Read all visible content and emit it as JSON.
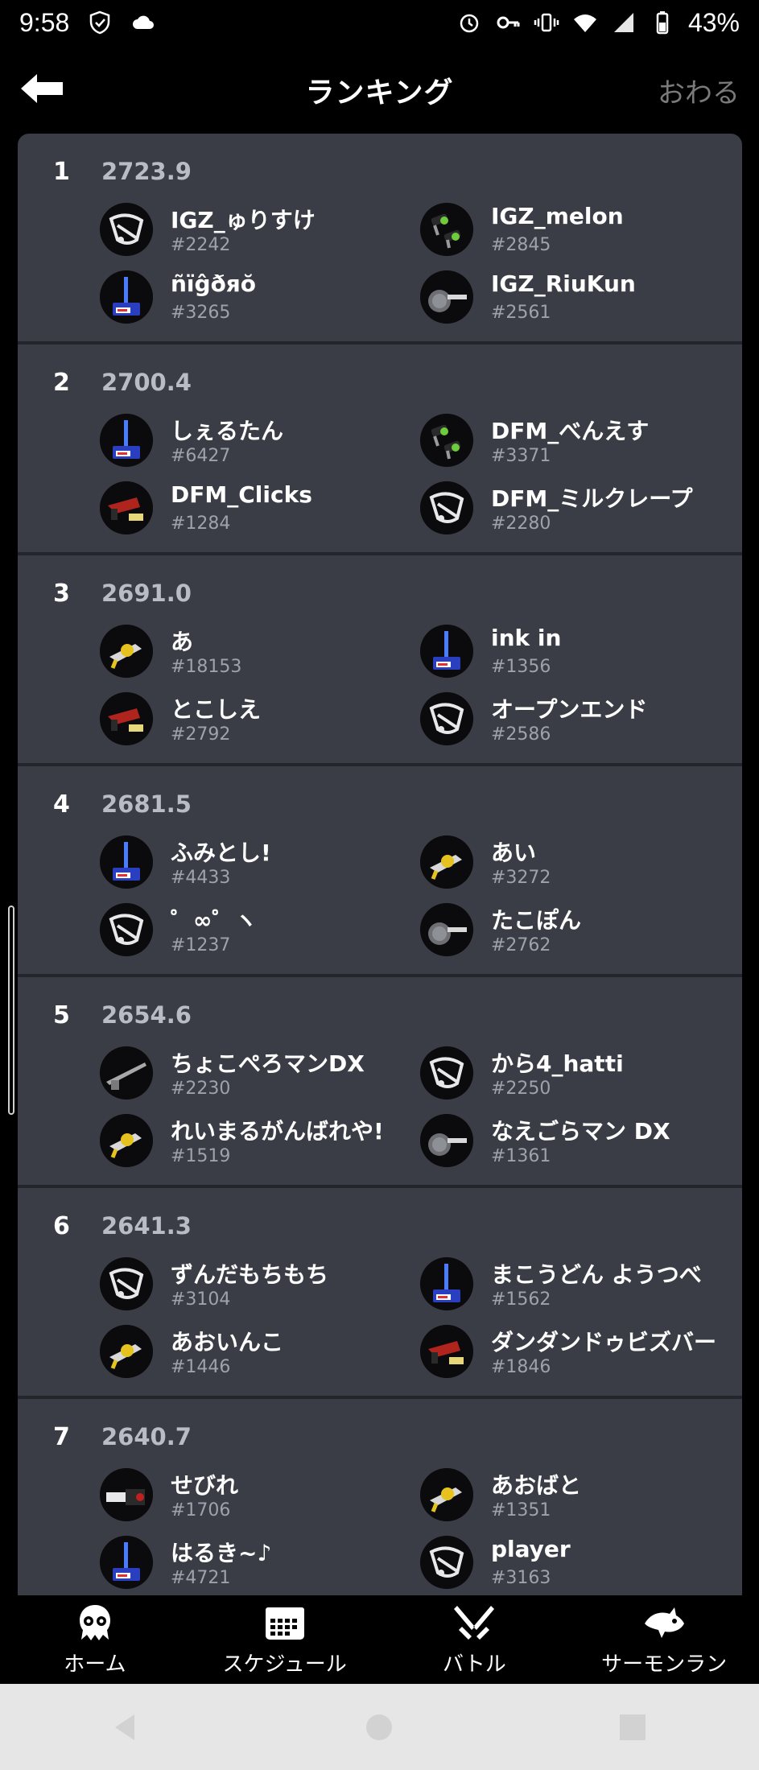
{
  "status_bar": {
    "time": "9:58",
    "battery": "43%",
    "icons": [
      "shield-icon",
      "cloud-icon",
      "alarm-icon",
      "key-icon",
      "vibrate-icon",
      "wifi-icon",
      "signal-icon",
      "battery-icon"
    ]
  },
  "header": {
    "title": "ランキング",
    "quit_label": "おわる",
    "back_icon": "back-arrow-icon"
  },
  "colors": {
    "background": "#000000",
    "panel": "#3a3d45",
    "divider": "#23252b",
    "score": "#b8bcc4",
    "tag": "#9ea2aa",
    "quit": "#7a7a7a"
  },
  "rankings": [
    {
      "rank": "1",
      "score": "2723.9",
      "players": [
        {
          "name": "IGZ_ゅりすけ",
          "tag": "#2242",
          "weapon": "brella"
        },
        {
          "name": "IGZ_melon",
          "tag": "#2845",
          "weapon": "dualie-green"
        },
        {
          "name": "ñïĝðяŏ",
          "tag": "#3265",
          "weapon": "roller-blue"
        },
        {
          "name": "IGZ_RiuKun",
          "tag": "#2561",
          "weapon": "brush-gray"
        }
      ]
    },
    {
      "rank": "2",
      "score": "2700.4",
      "players": [
        {
          "name": "しぇるたん",
          "tag": "#6427",
          "weapon": "roller-blue"
        },
        {
          "name": "DFM_べんえす",
          "tag": "#3371",
          "weapon": "dualie-green"
        },
        {
          "name": "DFM_Clicks",
          "tag": "#1284",
          "weapon": "blaster-red"
        },
        {
          "name": "DFM_ミルクレープ",
          "tag": "#2280",
          "weapon": "brella"
        }
      ]
    },
    {
      "rank": "3",
      "score": "2691.0",
      "players": [
        {
          "name": "あ",
          "tag": "#18153",
          "weapon": "gun-yellow"
        },
        {
          "name": "ink in",
          "tag": "#1356",
          "weapon": "roller-blue"
        },
        {
          "name": "とこしえ",
          "tag": "#2792",
          "weapon": "blaster-red"
        },
        {
          "name": "オープンエンド",
          "tag": "#2586",
          "weapon": "brella"
        }
      ]
    },
    {
      "rank": "4",
      "score": "2681.5",
      "players": [
        {
          "name": "ふみとし!",
          "tag": "#4433",
          "weapon": "roller-blue"
        },
        {
          "name": "あい",
          "tag": "#3272",
          "weapon": "gun-yellow"
        },
        {
          "name": "゜∞゜ヽ",
          "tag": "#1237",
          "weapon": "brella"
        },
        {
          "name": "たこぽん",
          "tag": "#2762",
          "weapon": "brush-gray"
        }
      ]
    },
    {
      "rank": "5",
      "score": "2654.6",
      "players": [
        {
          "name": " ちょこぺろマンDX",
          "tag": "#2230",
          "weapon": "charger-gray"
        },
        {
          "name": "から4_hatti",
          "tag": "#2250",
          "weapon": "brella"
        },
        {
          "name": "れいまるがんばれや!",
          "tag": "#1519",
          "weapon": "gun-yellow"
        },
        {
          "name": "なえごらマン DX",
          "tag": "#1361",
          "weapon": "brush-gray"
        }
      ]
    },
    {
      "rank": "6",
      "score": "2641.3",
      "players": [
        {
          "name": "ずんだもちもち",
          "tag": "#3104",
          "weapon": "brella"
        },
        {
          "name": "まこうどん ようつべ",
          "tag": "#1562",
          "weapon": "roller-blue"
        },
        {
          "name": "あおいんこ",
          "tag": "#1446",
          "weapon": "gun-yellow"
        },
        {
          "name": "ダンダンドゥビズバー",
          "tag": "#1846",
          "weapon": "blaster-red"
        }
      ]
    },
    {
      "rank": "7",
      "score": "2640.7",
      "players": [
        {
          "name": "せびれ",
          "tag": "#1706",
          "weapon": "splatling-red"
        },
        {
          "name": "あおばと",
          "tag": "#1351",
          "weapon": "gun-yellow"
        },
        {
          "name": "はるき~♪",
          "tag": "#4721",
          "weapon": "roller-blue"
        },
        {
          "name": "player",
          "tag": "#3163",
          "weapon": "brella"
        }
      ]
    }
  ],
  "bottom_nav": [
    {
      "label": "ホーム",
      "icon": "squid-home-icon"
    },
    {
      "label": "スケジュール",
      "icon": "calendar-icon"
    },
    {
      "label": "バトル",
      "icon": "battle-icon"
    },
    {
      "label": "サーモンラン",
      "icon": "salmon-icon"
    }
  ],
  "system_nav": [
    "back-triangle-icon",
    "home-circle-icon",
    "recents-square-icon"
  ]
}
